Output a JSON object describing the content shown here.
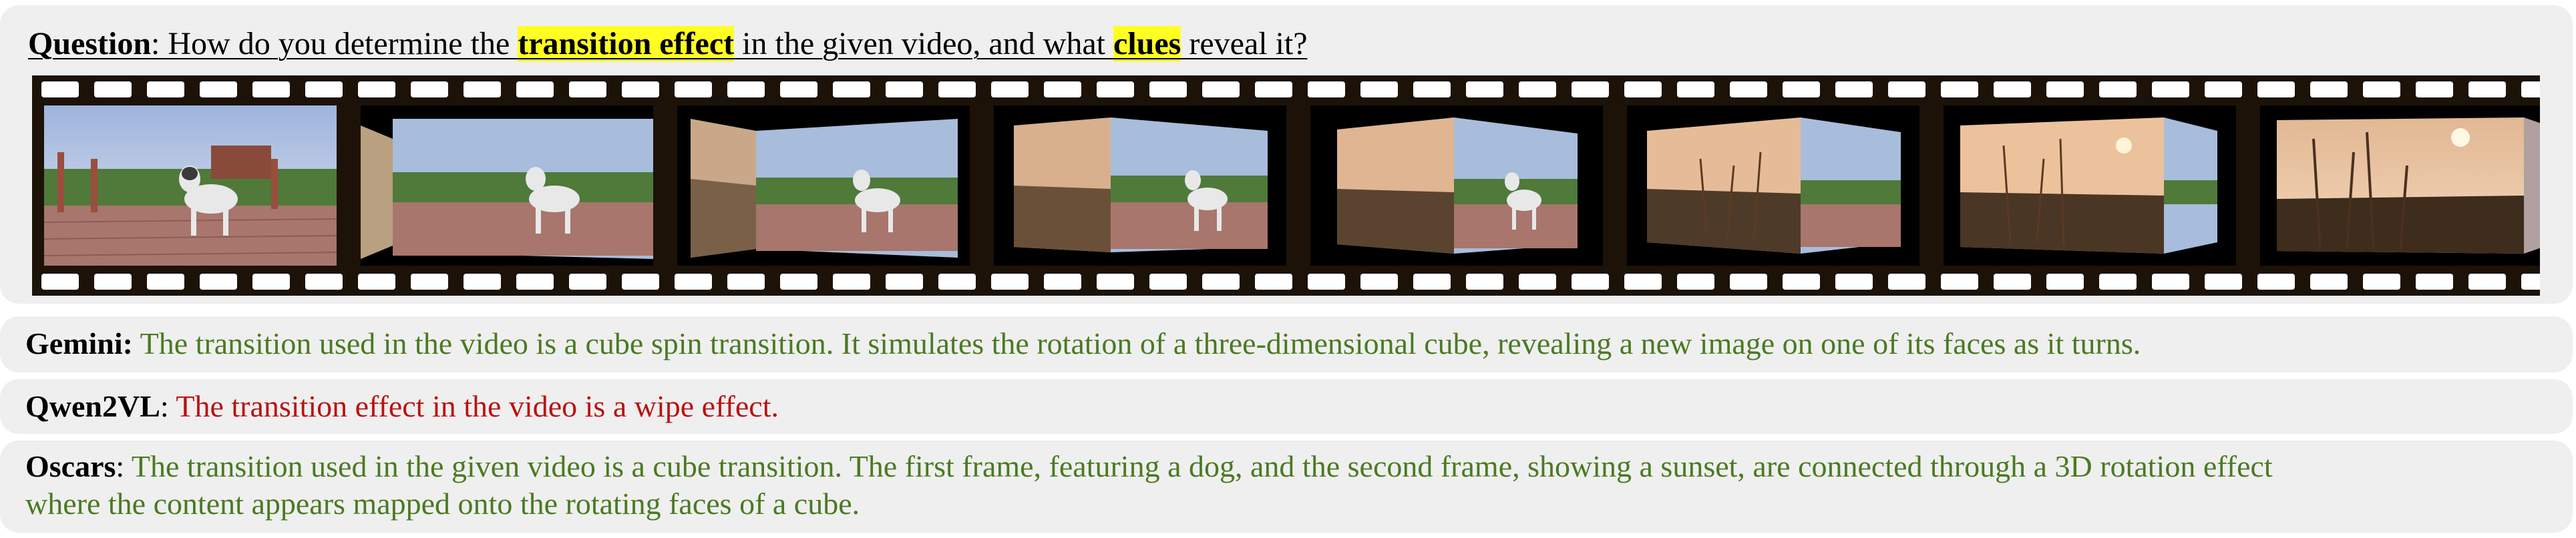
{
  "question": {
    "label": "Question",
    "text_1": ": How do you determine the ",
    "highlight_1": "transition effect",
    "text_2": " in the given video, and what ",
    "highlight_2": "clues",
    "text_3": " reveal it?"
  },
  "filmstrip": {
    "frame_count": 8,
    "frames": [
      {
        "description": "husky on wooden deck"
      },
      {
        "description": "cube rotation, dog face dominant"
      },
      {
        "description": "cube rotation, dog face dominant"
      },
      {
        "description": "cube rotation, sunset face emerging"
      },
      {
        "description": "cube rotation, halfway"
      },
      {
        "description": "cube rotation, sunset face dominant"
      },
      {
        "description": "cube rotation, sunset face dominant"
      },
      {
        "description": "sunset over reeds"
      }
    ]
  },
  "answers": {
    "gemini": {
      "label": "Gemini:",
      "text": " The transition used in the video is a cube spin transition. It simulates the rotation of a three-dimensional cube, revealing a new image on one of its faces as it turns.",
      "color": "#4a7a22"
    },
    "qwen": {
      "label": "Qwen2VL",
      "colon": ":",
      "text": " The transition effect in the video is a wipe effect.",
      "color": "#bb1111"
    },
    "oscars": {
      "label": "Oscars",
      "colon": ":",
      "text_line1": " The transition used in the given video is a cube transition. The first frame, featuring a dog, and the second frame, showing a sunset, are connected through a 3D rotation effect",
      "text_line2": "where the content appears mapped onto the rotating faces of a cube.",
      "color": "#4a7a22"
    }
  }
}
